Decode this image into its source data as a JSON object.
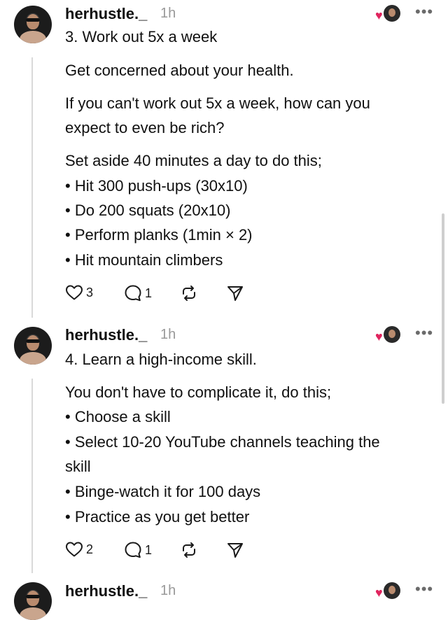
{
  "posts": [
    {
      "username": "herhustle._",
      "time": "1h",
      "lines": [
        "3. Work out 5x a week",
        "Get concerned about your health.",
        "If you can't work out 5x a week, how can you",
        "expect to even be rich?",
        "Set aside 40 minutes a day to do this;",
        "• Hit 300 push-ups (30x10)",
        "• Do 200 squats (20x10)",
        "• Perform planks (1min × 2)",
        "• Hit mountain climbers"
      ],
      "likes": "3",
      "replies": "1"
    },
    {
      "username": "herhustle._",
      "time": "1h",
      "lines": [
        "4. Learn a high-income skill.",
        "You don't have to complicate it, do this;",
        "• Choose a skill",
        "• Select 10-20 YouTube channels teaching the",
        "skill",
        "• Binge-watch it for 100 days",
        "• Practice as you get better"
      ],
      "likes": "2",
      "replies": "1"
    },
    {
      "username": "herhustle._",
      "time": "1h"
    }
  ],
  "icons": {
    "more": "more-icon",
    "like": "heart-icon",
    "reply": "comment-icon",
    "repost": "repost-icon",
    "share": "send-icon"
  },
  "colors": {
    "text": "#101010",
    "muted": "#999999",
    "heart": "#e0245e",
    "thread_line": "#d9d9d9"
  }
}
